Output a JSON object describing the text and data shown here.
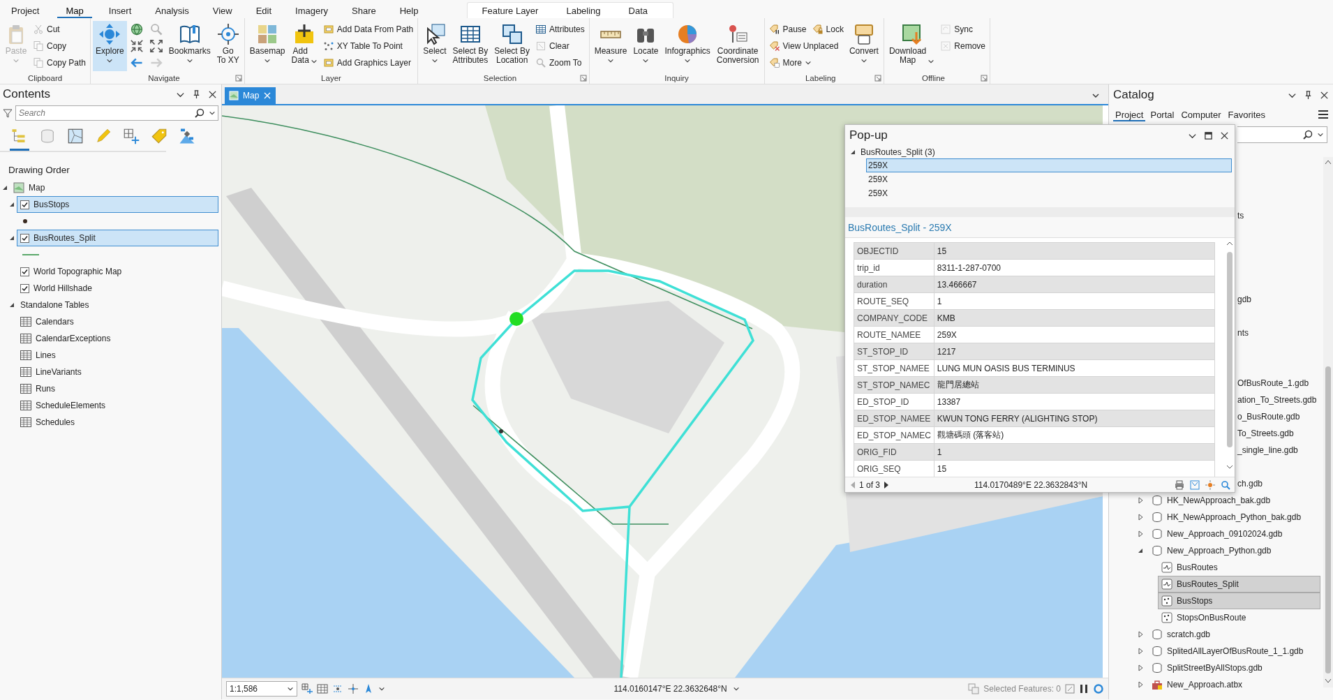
{
  "ribbon": {
    "tabs": [
      {
        "label": "Project",
        "selected": false
      },
      {
        "label": "Map",
        "selected": true
      },
      {
        "label": "Insert",
        "selected": false
      },
      {
        "label": "Analysis",
        "selected": false
      },
      {
        "label": "View",
        "selected": false
      },
      {
        "label": "Edit",
        "selected": false
      },
      {
        "label": "Imagery",
        "selected": false
      },
      {
        "label": "Share",
        "selected": false
      },
      {
        "label": "Help",
        "selected": false
      }
    ],
    "context_tabs": [
      {
        "label": "Feature Layer",
        "selected": false
      },
      {
        "label": "Labeling",
        "selected": false
      },
      {
        "label": "Data",
        "selected": false
      }
    ],
    "groups": [
      {
        "title": "Clipboard",
        "launcher": false,
        "columns": [
          {
            "kind": "large",
            "label": "Paste",
            "disabled": true,
            "active": false,
            "menu": true
          },
          {
            "kind": "stack",
            "rows": [
              [
                {
                  "label": "Cut",
                  "disabled": true
                }
              ],
              [
                {
                  "label": "Copy",
                  "disabled": true
                }
              ],
              [
                {
                  "label": "Copy Path",
                  "disabled": true
                }
              ]
            ]
          }
        ]
      },
      {
        "title": "Navigate",
        "launcher": true,
        "columns": [
          {
            "kind": "large",
            "label": "Explore",
            "disabled": false,
            "active": true,
            "menu": true
          },
          {
            "kind": "stack",
            "rows": [
              [
                {
                  "disabled": false
                },
                {
                  "disabled": true
                }
              ],
              [
                {
                  "disabled": false
                },
                {
                  "disabled": false
                }
              ],
              [
                {
                  "disabled": false
                },
                {
                  "disabled": true
                }
              ]
            ]
          },
          {
            "kind": "large",
            "label": "Bookmarks",
            "disabled": false,
            "active": false,
            "menu": true
          },
          {
            "kind": "large",
            "label": "Go\nTo XY",
            "disabled": false,
            "active": false
          }
        ]
      },
      {
        "title": "Layer",
        "launcher": false,
        "columns": [
          {
            "kind": "large",
            "label": "Basemap",
            "disabled": false,
            "active": false,
            "menu": true
          },
          {
            "kind": "large",
            "label": "Add\nData",
            "disabled": false,
            "active": false,
            "menu": true,
            "menu_inline": true
          },
          {
            "kind": "stack",
            "rows": [
              [
                {
                  "label": "Add Data From Path",
                  "disabled": false
                }
              ],
              [
                {
                  "label": "XY Table To Point",
                  "disabled": false
                }
              ],
              [
                {
                  "label": "Add Graphics Layer",
                  "disabled": false
                }
              ]
            ]
          }
        ]
      },
      {
        "title": "Selection",
        "launcher": true,
        "columns": [
          {
            "kind": "large",
            "label": "Select",
            "disabled": false,
            "active": false,
            "menu": true
          },
          {
            "kind": "large",
            "label": "Select By\nAttributes",
            "disabled": false,
            "active": false
          },
          {
            "kind": "large",
            "label": "Select By\nLocation",
            "disabled": false,
            "active": false
          },
          {
            "kind": "stack",
            "rows": [
              [
                {
                  "label": "Attributes",
                  "disabled": false
                }
              ],
              [
                {
                  "label": "Clear",
                  "disabled": true
                }
              ],
              [
                {
                  "label": "Zoom To",
                  "disabled": true
                }
              ]
            ]
          }
        ]
      },
      {
        "title": "Inquiry",
        "launcher": false,
        "columns": [
          {
            "kind": "large",
            "label": "Measure",
            "disabled": false,
            "active": false,
            "menu": true
          },
          {
            "kind": "large",
            "label": "Locate",
            "disabled": false,
            "active": false,
            "menu": true
          },
          {
            "kind": "large",
            "label": "Infographics",
            "disabled": false,
            "active": false,
            "menu": true
          },
          {
            "kind": "large",
            "label": "Coordinate\nConversion",
            "disabled": false,
            "active": false
          }
        ]
      },
      {
        "title": "Labeling",
        "launcher": true,
        "columns": [
          {
            "kind": "stack",
            "rows": [
              [
                {
                  "label": "Pause",
                  "disabled": false
                },
                {
                  "label": "Lock",
                  "disabled": false
                }
              ],
              [
                {
                  "label": "View Unplaced",
                  "disabled": false
                }
              ],
              [
                {
                  "label": "More",
                  "disabled": false,
                  "menu": true
                }
              ]
            ]
          },
          {
            "kind": "large",
            "label": "Convert",
            "disabled": false,
            "active": false,
            "menu": true
          }
        ]
      },
      {
        "title": "Offline",
        "launcher": true,
        "columns": [
          {
            "kind": "large",
            "label": "Download\nMap",
            "disabled": false,
            "active": false,
            "menu": true,
            "menu_inline": true
          },
          {
            "kind": "stack",
            "rows": [
              [
                {
                  "label": "Sync",
                  "disabled": true
                }
              ],
              [
                {
                  "label": "Remove",
                  "disabled": true
                }
              ]
            ]
          }
        ]
      }
    ]
  },
  "contents": {
    "title": "Contents",
    "search_placeholder": "Search",
    "views": [
      {
        "selected": true
      },
      {
        "selected": false
      },
      {
        "selected": false
      },
      {
        "selected": false
      },
      {
        "selected": false
      },
      {
        "selected": false
      },
      {
        "selected": false
      }
    ],
    "heading": "Drawing Order",
    "tree": [
      {
        "label": "Map",
        "kind": "map",
        "expanded": true,
        "children": [
          {
            "label": "BusStops",
            "kind": "layer",
            "checked": true,
            "selected": true,
            "expanded": true,
            "legend": {
              "kind": "point"
            }
          },
          {
            "label": "BusRoutes_Split",
            "kind": "layer",
            "checked": true,
            "selected": true,
            "expanded": true,
            "legend": {
              "kind": "line"
            }
          },
          {
            "label": "World Topographic Map",
            "kind": "layer",
            "checked": true,
            "selected": false
          },
          {
            "label": "World Hillshade",
            "kind": "layer",
            "checked": true,
            "selected": false
          },
          {
            "label": "Standalone Tables",
            "expanded": true,
            "children": [
              {
                "label": "Calendars",
                "kind": "table"
              },
              {
                "label": "CalendarExceptions",
                "kind": "table"
              },
              {
                "label": "Lines",
                "kind": "table"
              },
              {
                "label": "LineVariants",
                "kind": "table"
              },
              {
                "label": "Runs",
                "kind": "table"
              },
              {
                "label": "ScheduleElements",
                "kind": "table"
              },
              {
                "label": "Schedules",
                "kind": "table"
              }
            ]
          }
        ]
      }
    ]
  },
  "map": {
    "tab": {
      "label": "Map",
      "selected": true
    },
    "status_bar": {
      "scale": "1:1,586",
      "coordinates": "114.0160147°E 22.3632648°N",
      "selected_features": "Selected Features: 0"
    }
  },
  "catalog": {
    "title": "Catalog",
    "tabs": [
      {
        "label": "Project",
        "selected": true
      },
      {
        "label": "Portal",
        "selected": false
      },
      {
        "label": "Computer",
        "selected": false
      },
      {
        "label": "Favorites",
        "selected": false
      }
    ],
    "covered_rows": [
      {
        "label": "ts"
      },
      {
        "label": "gdb"
      },
      {
        "label": "nts"
      },
      {
        "label": "OfBusRoute_1.gdb"
      },
      {
        "label": "ation_To_Streets.gdb"
      },
      {
        "label": "o_BusRoute.gdb"
      },
      {
        "label": "To_Streets.gdb"
      },
      {
        "label": "_single_line.gdb"
      },
      {
        "label": "ch.gdb"
      }
    ],
    "tree": [
      {
        "label": "HK_NewApproach_bak.gdb",
        "kind": "gdb",
        "expanded": false,
        "selected": false
      },
      {
        "label": "HK_NewApproach_Python_bak.gdb",
        "kind": "gdb",
        "expanded": false,
        "selected": false
      },
      {
        "label": "New_Approach_09102024.gdb",
        "kind": "gdb",
        "expanded": false,
        "selected": false
      },
      {
        "label": "New_Approach_Python.gdb",
        "kind": "gdb",
        "expanded": true,
        "selected": false,
        "children": [
          {
            "label": "BusRoutes",
            "kind": "line",
            "selected": false
          },
          {
            "label": "BusRoutes_Split",
            "kind": "line",
            "selected": true
          },
          {
            "label": "BusStops",
            "kind": "point",
            "selected": true
          },
          {
            "label": "StopsOnBusRoute",
            "kind": "point",
            "selected": false
          }
        ]
      },
      {
        "label": "scratch.gdb",
        "kind": "gdb",
        "expanded": false,
        "selected": false
      },
      {
        "label": "SplitedAllLayerOfBusRoute_1_1.gdb",
        "kind": "gdb",
        "expanded": false,
        "selected": false
      },
      {
        "label": "SplitStreetByAllStops.gdb",
        "kind": "gdb",
        "expanded": false,
        "selected": false
      },
      {
        "label": "New_Approach.atbx",
        "kind": "toolbox",
        "expanded": false,
        "selected": false
      }
    ]
  },
  "popup": {
    "title": "Pop-up",
    "layer": {
      "label": "BusRoutes_Split (3)",
      "expanded": true,
      "features": [
        {
          "label": "259X",
          "selected": true
        },
        {
          "label": "259X",
          "selected": false
        },
        {
          "label": "259X",
          "selected": false
        }
      ]
    },
    "heading": "BusRoutes_Split - 259X",
    "fields": [
      {
        "name": "OBJECTID",
        "value": "15"
      },
      {
        "name": "trip_id",
        "value": "8311-1-287-0700"
      },
      {
        "name": "duration",
        "value": "13.466667"
      },
      {
        "name": "ROUTE_SEQ",
        "value": "1"
      },
      {
        "name": "COMPANY_CODE",
        "value": "KMB"
      },
      {
        "name": "ROUTE_NAMEE",
        "value": "259X"
      },
      {
        "name": "ST_STOP_ID",
        "value": "1217"
      },
      {
        "name": "ST_STOP_NAMEE",
        "value": "LUNG MUN OASIS BUS TERMINUS"
      },
      {
        "name": "ST_STOP_NAMEC",
        "value": "龍門居總站"
      },
      {
        "name": "ED_STOP_ID",
        "value": "13387"
      },
      {
        "name": "ED_STOP_NAMEE",
        "value": "KWUN TONG FERRY (ALIGHTING STOP)"
      },
      {
        "name": "ED_STOP_NAMEC",
        "value": "觀塘碼頭 (落客站)"
      },
      {
        "name": "ORIG_FID",
        "value": "1"
      },
      {
        "name": "ORIG_SEQ",
        "value": "15"
      }
    ],
    "pager": "1 of 3",
    "coordinates": "114.0170489°E 22.3632843°N"
  }
}
